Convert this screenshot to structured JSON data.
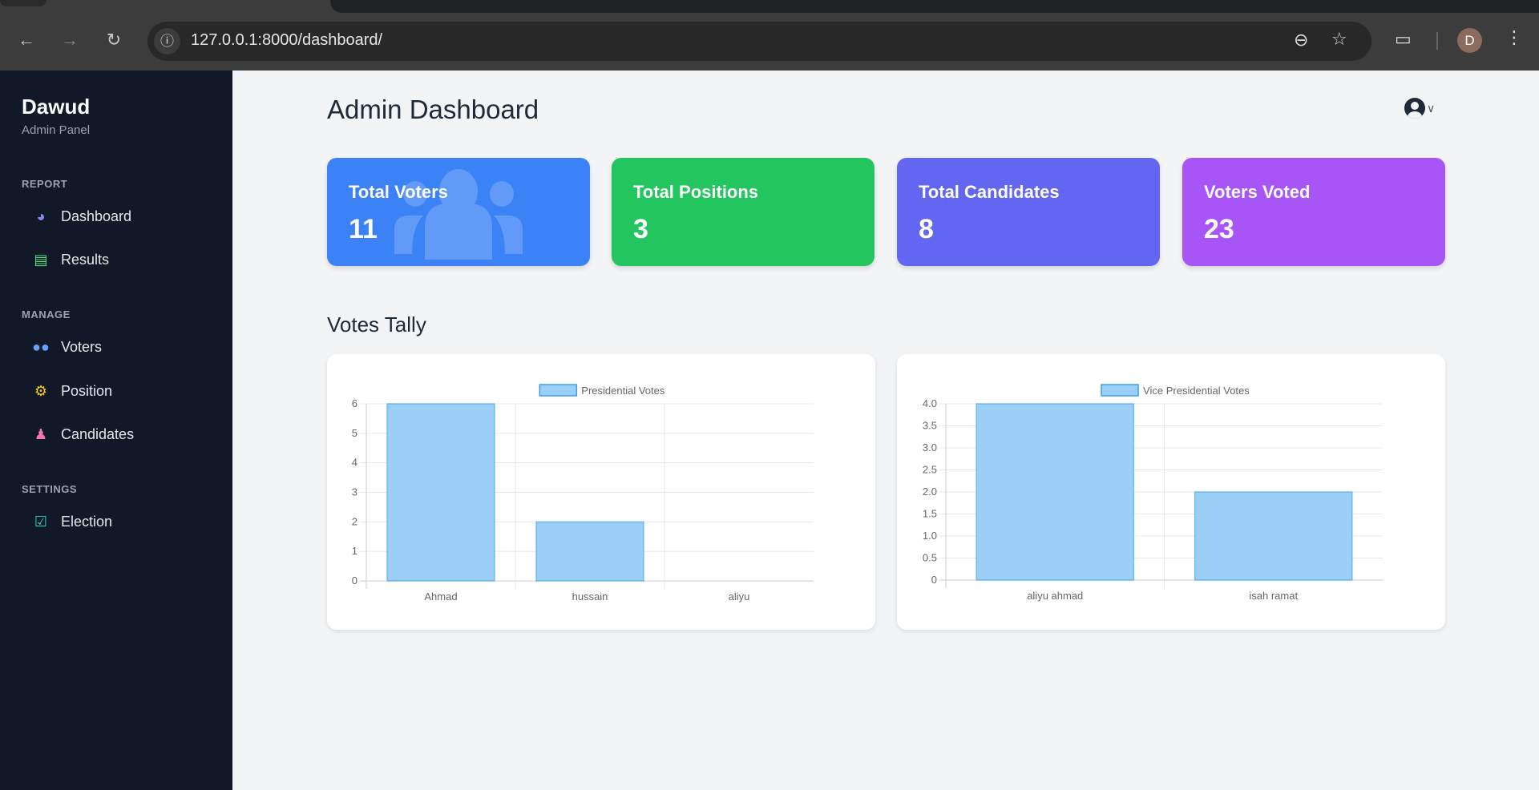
{
  "browser": {
    "url": "127.0.0.1:8000/dashboard/",
    "profile_initial": "D",
    "icons": [
      "back-icon",
      "forward-icon",
      "reload-icon",
      "info-icon",
      "zoom-out-icon",
      "star-icon",
      "extensions-icon",
      "menu-icon"
    ]
  },
  "sidebar": {
    "brand": "Dawud",
    "subtitle": "Admin Panel",
    "sections": [
      {
        "title": "REPORT",
        "items": [
          {
            "label": "Dashboard",
            "icon": "gauge-icon",
            "color": "#818cf8"
          },
          {
            "label": "Results",
            "icon": "chart-bar-icon",
            "color": "#4ade80"
          }
        ]
      },
      {
        "title": "MANAGE",
        "items": [
          {
            "label": "Voters",
            "icon": "users-icon",
            "color": "#60a5fa"
          },
          {
            "label": "Position",
            "icon": "gears-icon",
            "color": "#facc15"
          },
          {
            "label": "Candidates",
            "icon": "user-tie-icon",
            "color": "#f472b6"
          }
        ]
      },
      {
        "title": "SETTINGS",
        "items": [
          {
            "label": "Election",
            "icon": "vote-box-icon",
            "color": "#2dd4bf"
          }
        ]
      }
    ]
  },
  "header": {
    "title": "Admin Dashboard"
  },
  "stats": [
    {
      "label": "Total Voters",
      "value": "11",
      "color": "#3b82f6"
    },
    {
      "label": "Total Positions",
      "value": "3",
      "color": "#22c55e"
    },
    {
      "label": "Total Candidates",
      "value": "8",
      "color": "#6366f1"
    },
    {
      "label": "Voters Voted",
      "value": "23",
      "color": "#a855f7"
    }
  ],
  "tally_title": "Votes Tally",
  "chart_data": [
    {
      "type": "bar",
      "legend": "Presidential Votes",
      "legend_position": "top",
      "categories": [
        "Ahmad",
        "hussain",
        "aliyu"
      ],
      "values": [
        6,
        2,
        0
      ],
      "ylim": [
        0,
        6
      ],
      "yticks": [
        "0",
        "1",
        "2",
        "3",
        "4",
        "5",
        "6"
      ],
      "grid": true,
      "bar_color": "#9ccff5",
      "border_color": "#36a2eb"
    },
    {
      "type": "bar",
      "legend": "Vice Presidential Votes",
      "legend_position": "top",
      "categories": [
        "aliyu ahmad",
        "isah ramat"
      ],
      "values": [
        4,
        2
      ],
      "ylim": [
        0,
        4
      ],
      "yticks": [
        "0",
        "0.5",
        "1.0",
        "1.5",
        "2.0",
        "2.5",
        "3.0",
        "3.5",
        "4.0"
      ],
      "grid": true,
      "bar_color": "#9ccff5",
      "border_color": "#36a2eb"
    }
  ]
}
